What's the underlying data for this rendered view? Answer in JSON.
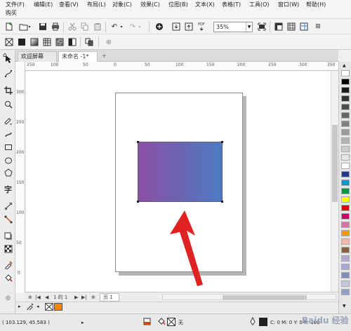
{
  "menu": [
    "文件(F)",
    "编辑(E)",
    "查看(V)",
    "布局(L)",
    "对象(C)",
    "效果(C)",
    "位图(B)",
    "文本(X)",
    "表格(T)",
    "工具(O)",
    "窗口(W)",
    "帮助(H)",
    "购买"
  ],
  "toolbar": {
    "zoom_value": "35%",
    "pdf_label": "PDF"
  },
  "tabs": {
    "welcome": "欢迎屏幕",
    "document": "未命名 -1*",
    "add": "+"
  },
  "rulers": {
    "top": [
      "250",
      "100",
      "50",
      "0",
      "50",
      "100",
      "150",
      "200",
      "250",
      "300",
      "350"
    ],
    "left": [
      "300",
      "250",
      "200",
      "150",
      "100",
      "50",
      "0"
    ]
  },
  "page_nav": {
    "page_indicator": "1 的 1",
    "page_tab": "页 1"
  },
  "status": {
    "coordinates": "( 103.129, 45.583 )",
    "fill_none": "无",
    "outline_info": "C: 0 M: 0 Y: 0 K: 100"
  },
  "watermark": "Baidu 经验",
  "colors": {
    "gradient_start": "#8c4fa6",
    "gradient_end": "#4c7cc2",
    "arrow": "#e02222",
    "palette": [
      "#ffffff",
      "#000000",
      "#1a1a1a",
      "#333333",
      "#4d4d4d",
      "#666666",
      "#808080",
      "#999999",
      "#b3b3b3",
      "#cccccc",
      "#e6e6e6",
      "#ffffff",
      "#1f3a93",
      "#0099cc",
      "#009944",
      "#ffff00",
      "#e60012",
      "#cc0066",
      "#d96fa5",
      "#f39800",
      "#f5b7a0",
      "#8b5e3c",
      "#b4a7d6",
      "#a8a8d8",
      "#7d8fbf",
      "#c1c9e0",
      "#8ca0c8"
    ]
  }
}
